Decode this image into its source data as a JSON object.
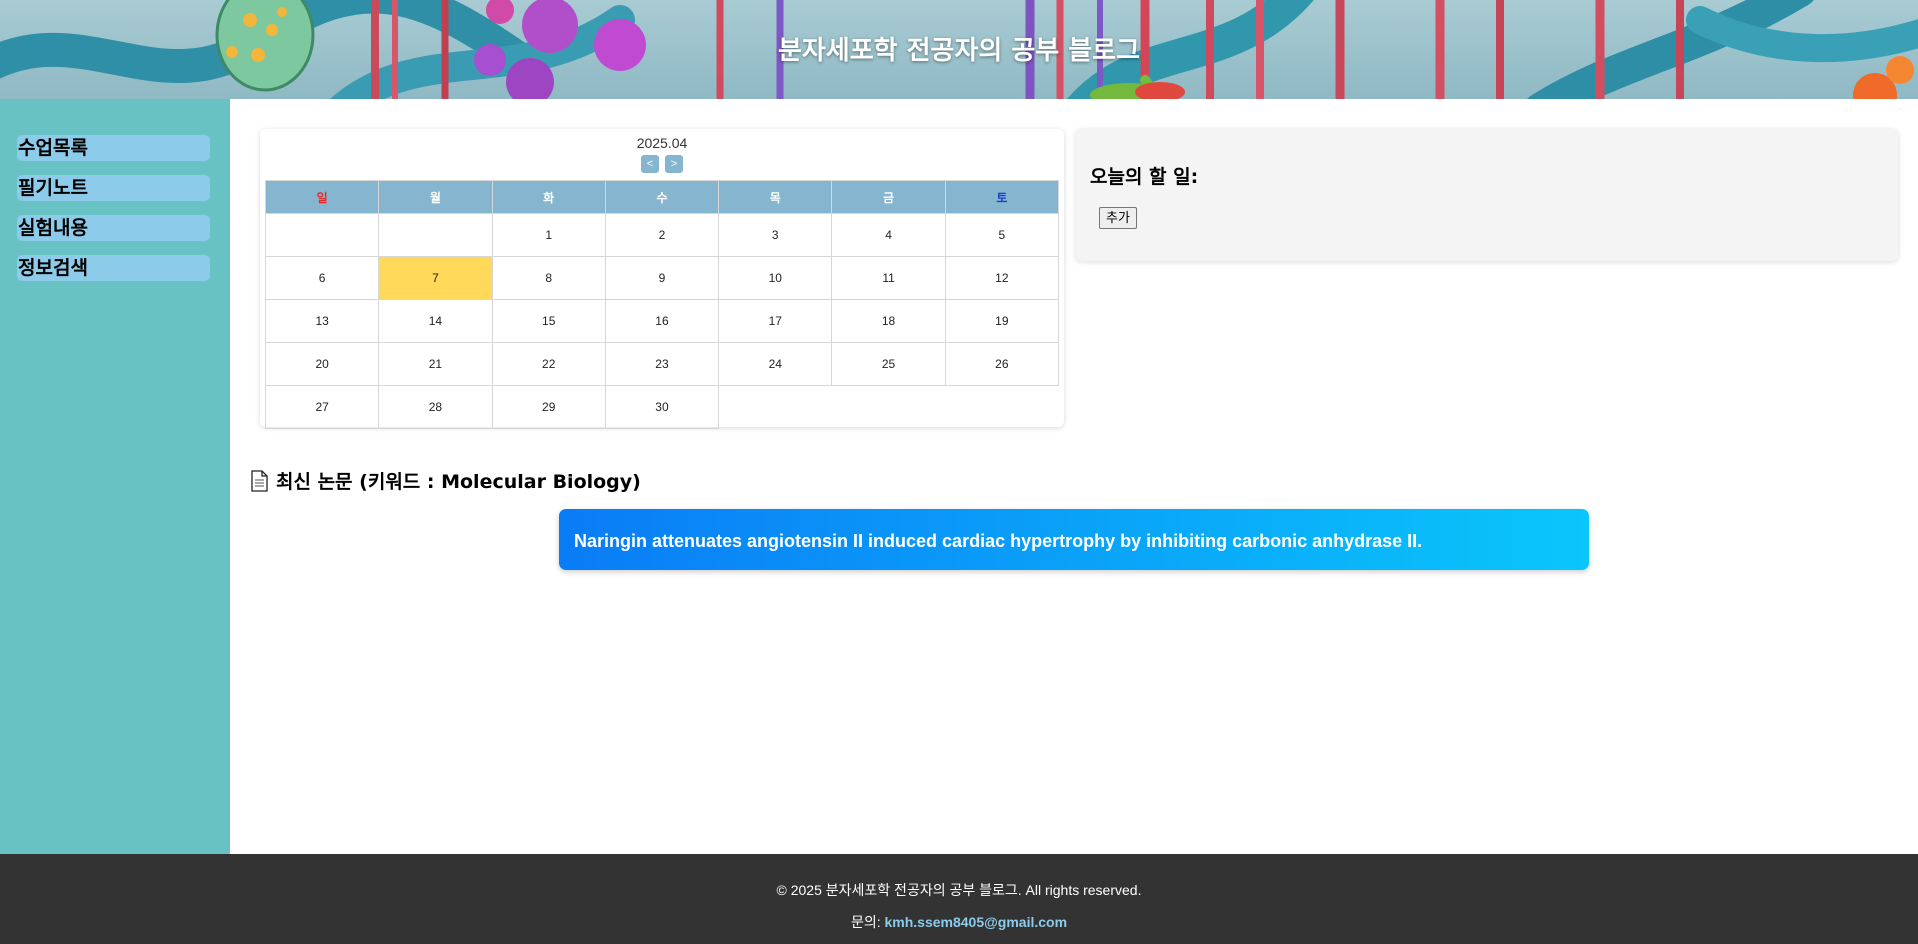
{
  "header": {
    "title": "분자세포학 전공자의 공부 블로그"
  },
  "sidebar": {
    "items": [
      {
        "label": "수업목록"
      },
      {
        "label": "필기노트"
      },
      {
        "label": "실험내용"
      },
      {
        "label": "정보검색"
      }
    ]
  },
  "calendar": {
    "month_label": "2025.04",
    "prev_label": "<",
    "next_label": ">",
    "weekdays": [
      "일",
      "월",
      "화",
      "수",
      "목",
      "금",
      "토"
    ],
    "today": "7",
    "weeks": [
      [
        "",
        "",
        "1",
        "2",
        "3",
        "4",
        "5"
      ],
      [
        "6",
        "7",
        "8",
        "9",
        "10",
        "11",
        "12"
      ],
      [
        "13",
        "14",
        "15",
        "16",
        "17",
        "18",
        "19"
      ],
      [
        "20",
        "21",
        "22",
        "23",
        "24",
        "25",
        "26"
      ],
      [
        "27",
        "28",
        "29",
        "30"
      ]
    ]
  },
  "todo": {
    "title": "오늘의 할 일:",
    "add_label": "추가"
  },
  "papers": {
    "heading": "최신 논문 (키워드 : Molecular Biology)",
    "items": [
      {
        "title": "Naringin attenuates angiotensin II induced cardiac hypertrophy by inhibiting carbonic anhydrase II."
      }
    ]
  },
  "footer": {
    "copyright": "© 2025 분자세포학 전공자의 공부 블로그. All rights reserved.",
    "contact_prefix": "문의: ",
    "email": "kmh.ssem8405@gmail.com"
  },
  "colors": {
    "sidebar_bg": "#68c2c3",
    "sidebar_item_bg": "#8ccbea",
    "calendar_header_bg": "#86b6cf",
    "today_highlight": "#ffd95a",
    "paper_gradient_start": "#0a7cf6",
    "paper_gradient_end": "#0ac6fb",
    "footer_bg": "#333333"
  }
}
